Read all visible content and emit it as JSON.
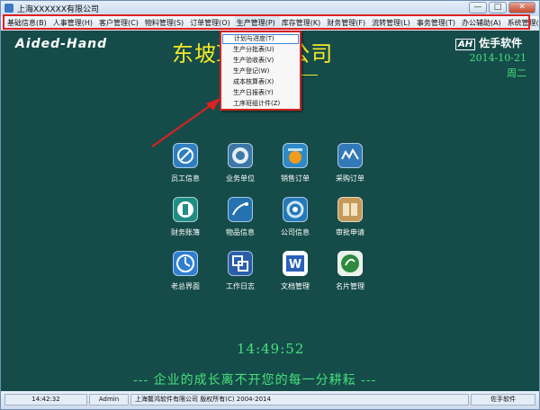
{
  "window": {
    "title": "上海XXXXXX有限公司",
    "buttons": {
      "minimize": "—",
      "maximize": "□",
      "close": "✕"
    }
  },
  "menubar": {
    "items": [
      {
        "label": "基础信息(B)"
      },
      {
        "label": "人事管理(H)"
      },
      {
        "label": "客户管理(C)"
      },
      {
        "label": "物料管理(S)"
      },
      {
        "label": "订单管理(O)"
      },
      {
        "label": "生产管理(P)"
      },
      {
        "label": "库存管理(K)"
      },
      {
        "label": "财务管理(F)"
      },
      {
        "label": "流转管理(L)"
      },
      {
        "label": "事务管理(T)"
      },
      {
        "label": "办公辅助(A)"
      },
      {
        "label": "系统管理(M)"
      }
    ]
  },
  "dropdown": {
    "items": [
      {
        "label": "计划与进度(T)"
      },
      {
        "label": "生产分批表(U)"
      },
      {
        "label": "生产验收表(V)"
      },
      {
        "label": "生产登记(W)"
      },
      {
        "label": "成本核算表(X)"
      },
      {
        "label": "生产日报表(Y)"
      },
      {
        "label": "工序班组计件(Z)"
      }
    ]
  },
  "header": {
    "brand_left": "Aided-Hand",
    "company_title": "东坡XXX限公司",
    "brand_logo": "AH",
    "brand_right": "佐手软件",
    "date": "2014-10-21",
    "weekday": "周二"
  },
  "tiles": [
    {
      "label": "员工信息",
      "icon": "employee-icon",
      "color": "#2f7fc0"
    },
    {
      "label": "业务单位",
      "icon": "business-unit-icon",
      "color": "#3b78a8"
    },
    {
      "label": "销售订单",
      "icon": "sales-order-icon",
      "color": "#2e89c6"
    },
    {
      "label": "采购订单",
      "icon": "purchase-order-icon",
      "color": "#3279b8"
    },
    {
      "label": "财务账簿",
      "icon": "finance-ledger-icon",
      "color": "#1f8d84"
    },
    {
      "label": "物品信息",
      "icon": "item-info-icon",
      "color": "#2572b0"
    },
    {
      "label": "公司信息",
      "icon": "company-info-icon",
      "color": "#2579b8"
    },
    {
      "label": "审批申请",
      "icon": "approval-request-icon",
      "color": "#c49a5a"
    },
    {
      "label": "老总界面",
      "icon": "boss-view-icon",
      "color": "#2f7ed0"
    },
    {
      "label": "工作日志",
      "icon": "work-log-icon",
      "color": "#2a5ea8"
    },
    {
      "label": "文档管理",
      "icon": "document-icon",
      "color": "#2961b8"
    },
    {
      "label": "名片管理",
      "icon": "business-card-icon",
      "color": "#2d8a3e"
    }
  ],
  "clock": "14:49:52",
  "slogan": "--- 企业的成长离不开您的每一分耕耘 ---",
  "statusbar": {
    "time": "14:42:32",
    "user": "Admin",
    "copyright": "上海鳌鸿软件有限公司 版权所有(C) 2004-2014",
    "product": "佐手软件"
  },
  "colors": {
    "main_background": "#154c4a",
    "title_yellow": "#f6e726",
    "clock_green": "#46e07a",
    "highlight_red": "#e02020"
  }
}
